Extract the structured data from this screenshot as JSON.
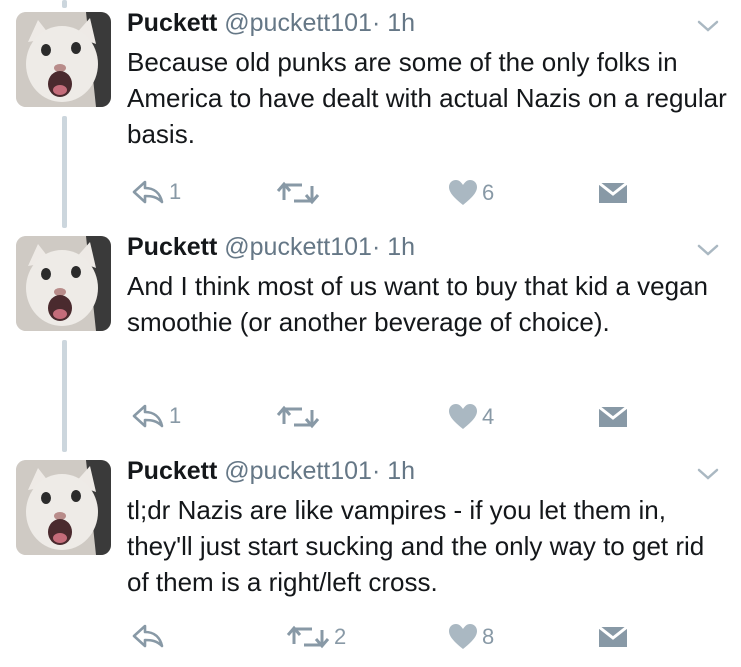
{
  "tweets": [
    {
      "name": "Puckett",
      "handle": "@puckett101",
      "separator": "·",
      "time": "1h",
      "text": "Because old punks are some of the only folks in America to have dealt with actual Nazis on a regular basis.",
      "reply_count": "1",
      "retweet_count": "",
      "like_count": "6"
    },
    {
      "name": "Puckett",
      "handle": "@puckett101",
      "separator": "·",
      "time": "1h",
      "text": "And I think most of us want to buy that kid a vegan smoothie (or another beverage of choice).",
      "reply_count": "1",
      "retweet_count": "",
      "like_count": "4"
    },
    {
      "name": "Puckett",
      "handle": "@puckett101",
      "separator": "·",
      "time": "1h",
      "text": "tl;dr Nazis are like vampires - if you let them in, they'll just start sucking and the only way to get rid of them is a right/left cross.",
      "reply_count": "",
      "retweet_count": "2",
      "like_count": "8"
    }
  ],
  "icons": {
    "avatar": "cat-avatar",
    "caret": "chevron-down-icon",
    "reply": "reply-icon",
    "retweet": "retweet-icon",
    "like": "heart-icon",
    "message": "envelope-icon"
  },
  "colors": {
    "text": "#14171a",
    "secondary": "#657786",
    "icon": "#8899a6",
    "thread_line": "#ccd6dd"
  }
}
